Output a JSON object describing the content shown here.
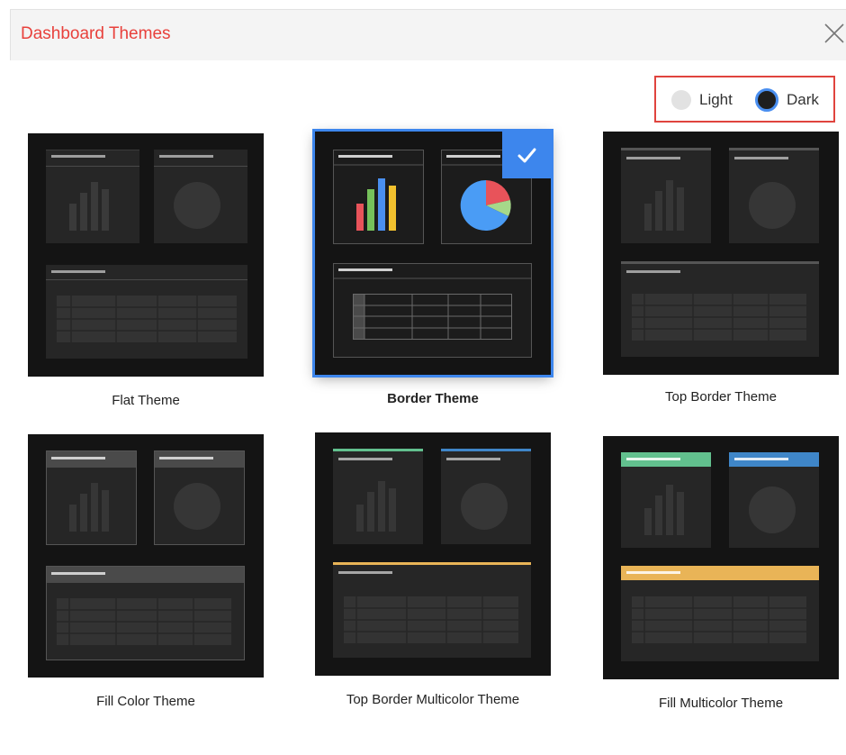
{
  "dialog": {
    "title": "Dashboard Themes"
  },
  "mode": {
    "light_label": "Light",
    "dark_label": "Dark",
    "selected": "Dark"
  },
  "themes": [
    {
      "name": "Flat Theme",
      "selected": false
    },
    {
      "name": "Border Theme",
      "selected": true
    },
    {
      "name": "Top Border Theme",
      "selected": false
    },
    {
      "name": "Fill Color Theme",
      "selected": false
    },
    {
      "name": "Top Border Multicolor Theme",
      "selected": false
    },
    {
      "name": "Fill Multicolor Theme",
      "selected": false
    }
  ],
  "colors": {
    "accent": "#3d86ed",
    "title_red": "#e8413c",
    "bar_red": "#e8535a",
    "bar_green": "#76c15b",
    "bar_blue": "#4a8ff0",
    "bar_yellow": "#f2c12e",
    "multi_green": "#62c08e",
    "multi_blue": "#3f86c8",
    "multi_yellow": "#e9b457"
  }
}
